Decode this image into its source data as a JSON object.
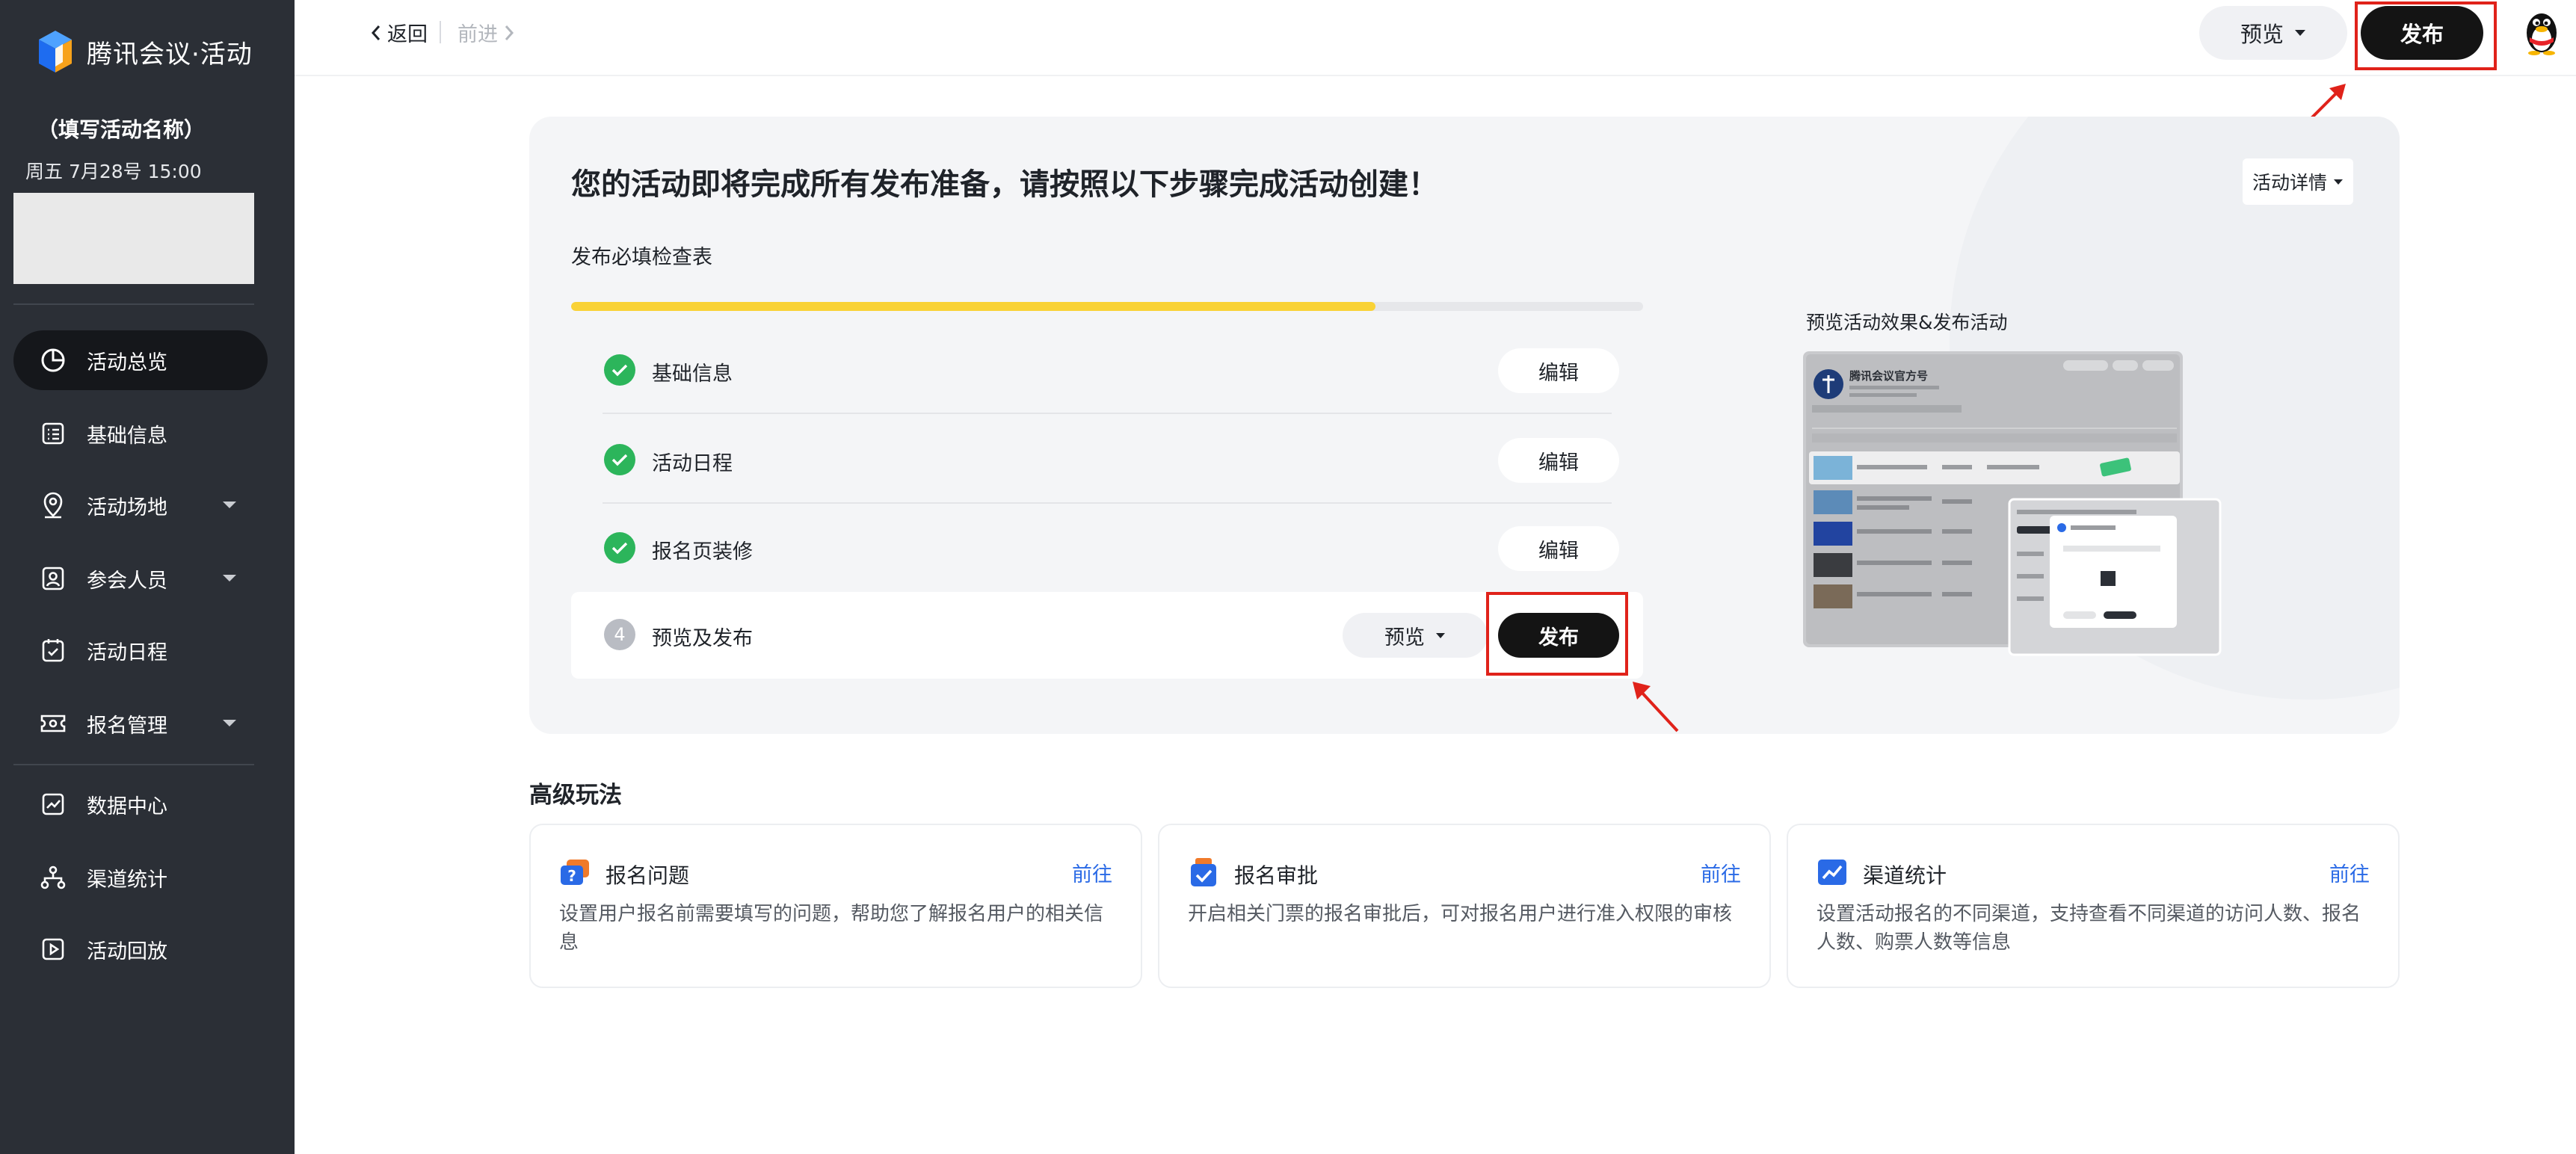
{
  "app": {
    "brand": "腾讯会议·活动",
    "event_name": "（填写活动名称）",
    "event_time": "周五  7月28号  15:00"
  },
  "sidebar": {
    "items": [
      {
        "label": "活动总览",
        "icon": "pie-chart-icon",
        "active": true,
        "has_caret": false
      },
      {
        "label": "基础信息",
        "icon": "list-icon",
        "active": false,
        "has_caret": false
      },
      {
        "label": "活动场地",
        "icon": "location-pin-icon",
        "active": false,
        "has_caret": true
      },
      {
        "label": "参会人员",
        "icon": "contact-card-icon",
        "active": false,
        "has_caret": true
      },
      {
        "label": "活动日程",
        "icon": "calendar-check-icon",
        "active": false,
        "has_caret": false
      },
      {
        "label": "报名管理",
        "icon": "ticket-icon",
        "active": false,
        "has_caret": true
      },
      {
        "label": "数据中心",
        "icon": "line-chart-icon",
        "active": false,
        "has_caret": false
      },
      {
        "label": "渠道统计",
        "icon": "network-icon",
        "active": false,
        "has_caret": false
      },
      {
        "label": "活动回放",
        "icon": "play-icon",
        "active": false,
        "has_caret": false
      }
    ]
  },
  "topbar": {
    "back": "返回",
    "forward": "前进",
    "preview": "预览",
    "publish": "发布"
  },
  "main": {
    "title": "您的活动即将完成所有发布准备，请按照以下步骤完成活动创建！",
    "detail_dropdown": "活动详情",
    "checklist_title": "发布必填检查表",
    "progress": 0.75,
    "steps": [
      {
        "label": "基础信息",
        "status": "done",
        "action": "编辑"
      },
      {
        "label": "活动日程",
        "status": "done",
        "action": "编辑"
      },
      {
        "label": "报名页装修",
        "status": "done",
        "action": "编辑"
      },
      {
        "number": "4",
        "label": "预览及发布",
        "status": "current",
        "preview": "预览",
        "action": "发布"
      }
    ],
    "preview_title": "预览活动效果&发布活动",
    "thumbnail": {
      "account_name": "腾讯会议官方号"
    }
  },
  "advanced": {
    "title": "高级玩法",
    "cards": [
      {
        "name": "报名问题",
        "go": "前往",
        "desc": "设置用户报名前需要填写的问题，帮助您了解报名用户的相关信息",
        "icon": "question-chat-icon"
      },
      {
        "name": "报名审批",
        "go": "前往",
        "desc": "开启相关门票的报名审批后，可对报名用户进行准入权限的审核",
        "icon": "approval-icon"
      },
      {
        "name": "渠道统计",
        "go": "前往",
        "desc": "设置活动报名的不同渠道，支持查看不同渠道的访问人数、报名人数、购票人数等信息",
        "icon": "trend-chart-icon"
      }
    ]
  },
  "colors": {
    "sidebar_bg": "#2b2f36",
    "accent_black": "#141414",
    "progress": "#f9d236",
    "success": "#2cb55b",
    "link": "#2a6ae6",
    "highlight": "#e0221a"
  }
}
